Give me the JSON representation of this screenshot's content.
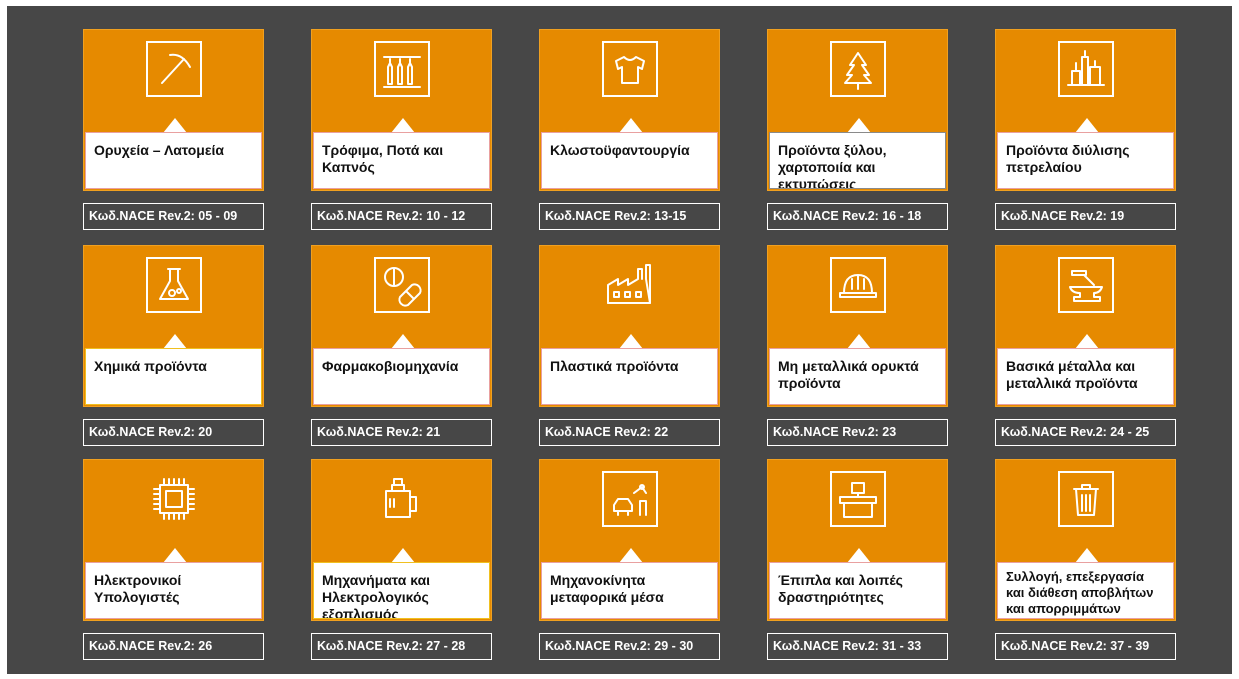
{
  "sectors": [
    {
      "icon": "pickaxe-icon",
      "title": "Ορυχεία – Λατομεία",
      "code": "Κωδ.NACE Rev.2: 05 - 09"
    },
    {
      "icon": "bottles-icon",
      "title": "Τρόφιμα, Ποτά και Καπνός",
      "code": "Κωδ.NACE Rev.2: 10 - 12"
    },
    {
      "icon": "tshirt-icon",
      "title": "Κλωστοϋφαντουργία",
      "code": "Κωδ.NACE Rev.2: 13-15"
    },
    {
      "icon": "tree-icon",
      "title": "Προϊόντα ξύλου, χαρτοποιία και εκτυπώσεις",
      "code": "Κωδ.NACE Rev.2: 16 - 18"
    },
    {
      "icon": "refinery-icon",
      "title": "Προϊόντα διύλισης πετρελαίου",
      "code": "Κωδ.NACE Rev.2: 19"
    },
    {
      "icon": "flask-icon",
      "title": "Χημικά προϊόντα",
      "code": "Κωδ.NACE Rev.2: 20"
    },
    {
      "icon": "pills-icon",
      "title": "Φαρμακοβιομηχανία",
      "code": "Κωδ.NACE Rev.2: 21"
    },
    {
      "icon": "factory-icon",
      "title": "Πλαστικά προϊόντα",
      "code": "Κωδ.NACE Rev.2: 22"
    },
    {
      "icon": "hardhat-icon",
      "title": "Μη μεταλλικά ορυκτά προϊόντα",
      "code": "Κωδ.NACE Rev.2: 23"
    },
    {
      "icon": "anvil-icon",
      "title": "Βασικά μέταλλα και μεταλλικά προϊόντα",
      "code": "Κωδ.NACE Rev.2: 24 - 25"
    },
    {
      "icon": "chip-icon",
      "title": "Ηλεκτρονικοί Υπολογιστές",
      "code": "Κωδ.NACE Rev.2: 26"
    },
    {
      "icon": "machine-icon",
      "title": "Μηχανήματα και Ηλεκτρολογικός εξοπλισμός",
      "code": "Κωδ.NACE Rev.2: 27 - 28"
    },
    {
      "icon": "car-robot-icon",
      "title": "Μηχανοκίνητα μεταφορικά μέσα",
      "code": "Κωδ.NACE Rev.2: 29 - 30"
    },
    {
      "icon": "desk-icon",
      "title": "Έπιπλα και λοιπές δραστηριότητες",
      "code": "Κωδ.NACE Rev.2: 31 - 33"
    },
    {
      "icon": "trash-icon",
      "title": "Συλλογή, επεξεργασία και διάθεση αποβλήτων και απορριμμάτων",
      "code": "Κωδ.NACE Rev.2: 37 - 39"
    }
  ]
}
